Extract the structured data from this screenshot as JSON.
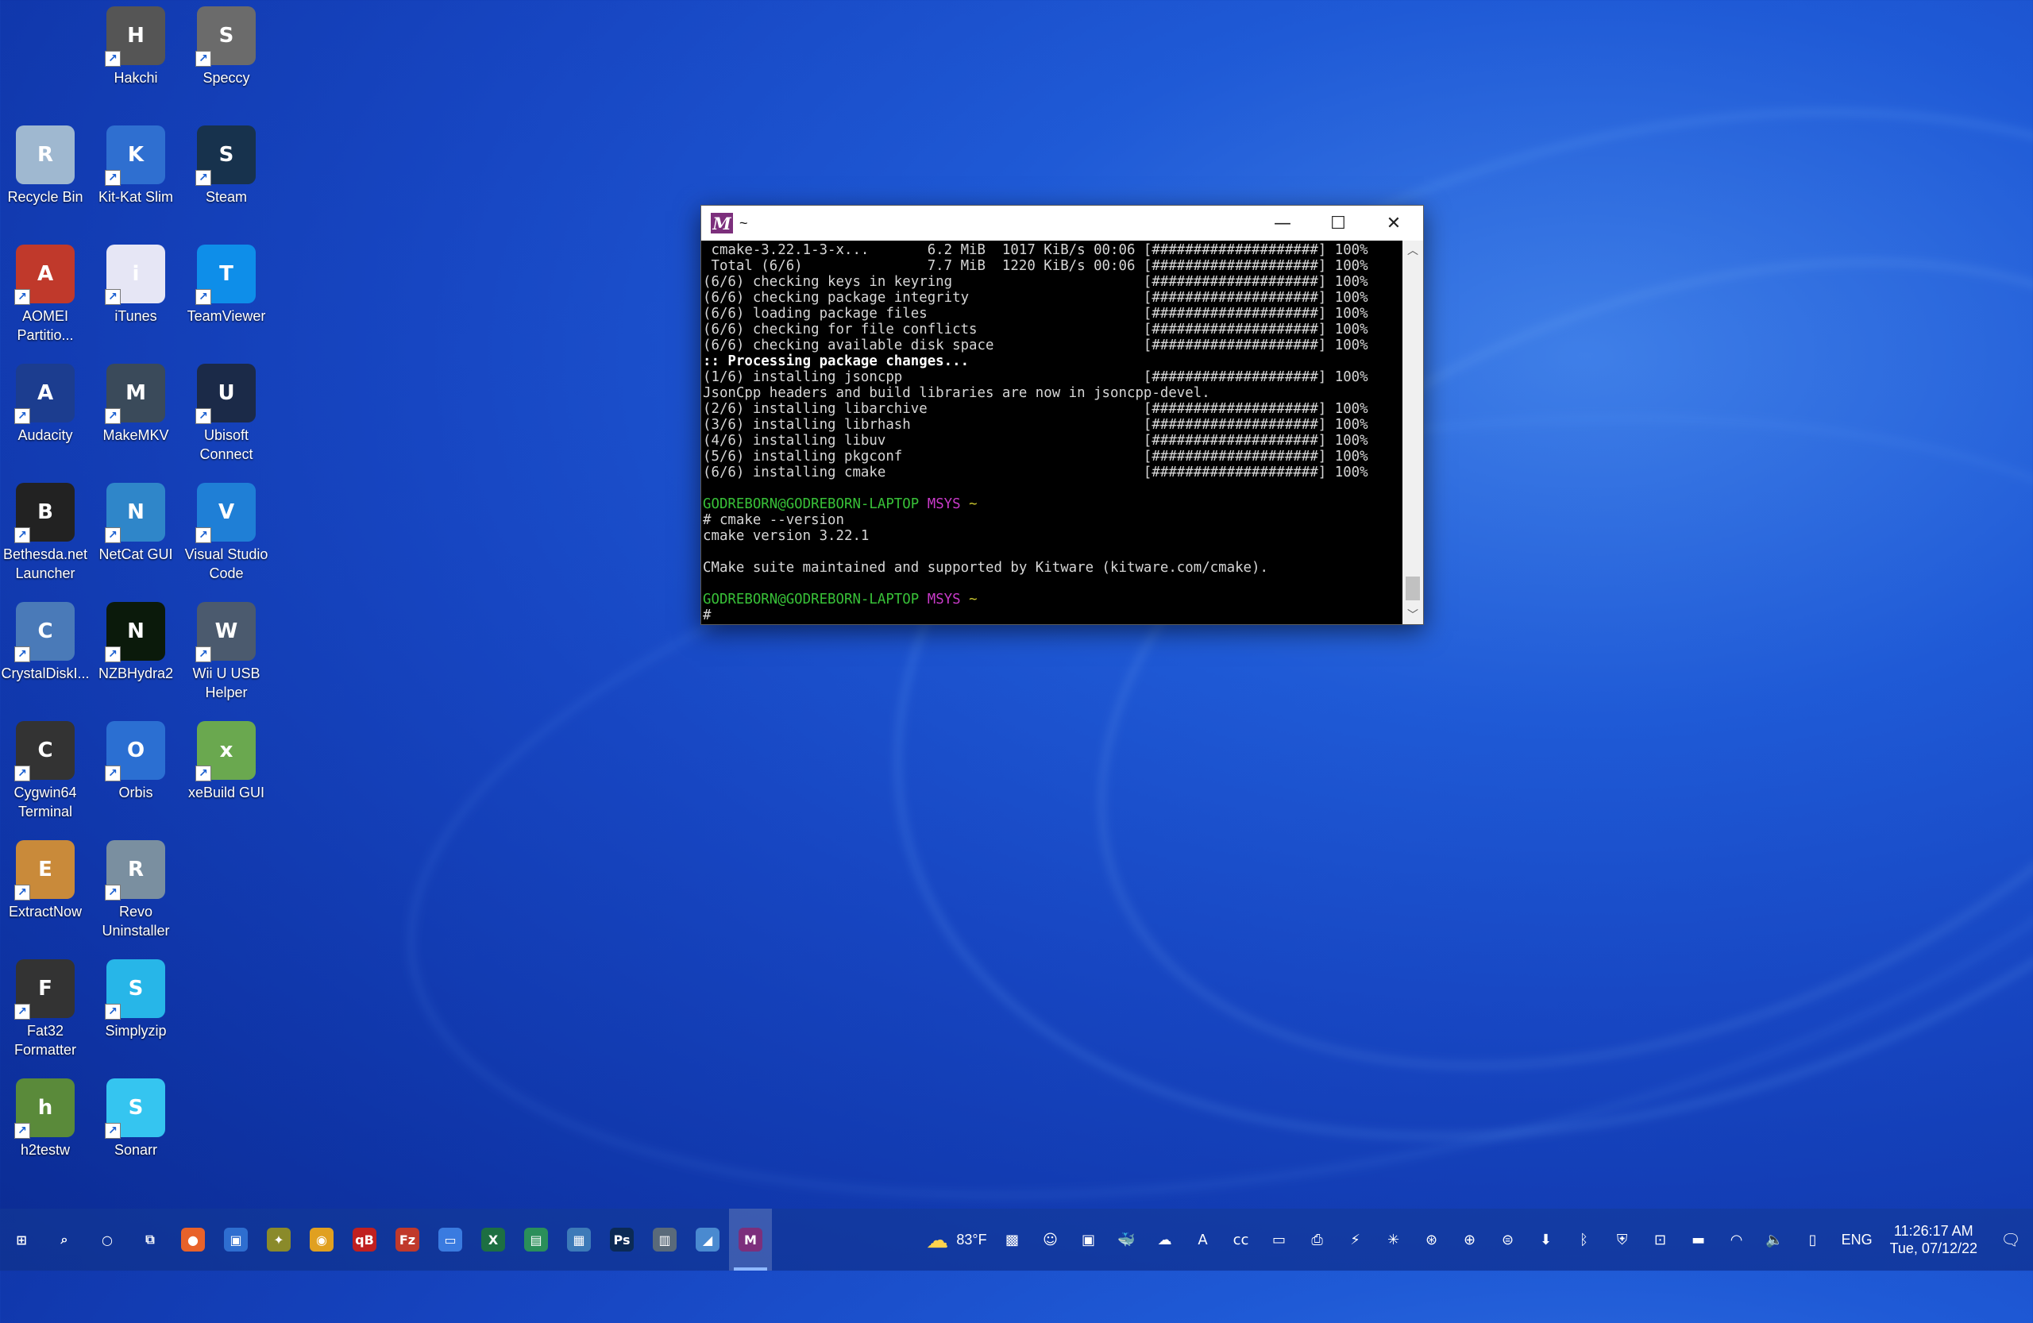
{
  "desktop": {
    "icons": [
      {
        "label": "Hakchi",
        "icon": "hakchi-icon",
        "color": "#555"
      },
      {
        "label": "Speccy",
        "icon": "speccy-icon",
        "color": "#6b6b6b"
      },
      {
        "label": "Recycle Bin",
        "icon": "recycle-bin-icon",
        "color": "#9fb8d0"
      },
      {
        "label": "Kit-Kat Slim",
        "icon": "kit-kat-slim-icon",
        "color": "#2f6fd0"
      },
      {
        "label": "Steam",
        "icon": "steam-icon",
        "color": "#17324d"
      },
      {
        "label": "AOMEI Partitio...",
        "icon": "aomei-icon",
        "color": "#c0392b"
      },
      {
        "label": "iTunes",
        "icon": "itunes-icon",
        "color": "#e6e6f5"
      },
      {
        "label": "TeamViewer",
        "icon": "teamviewer-icon",
        "color": "#0e8ee9"
      },
      {
        "label": "Audacity",
        "icon": "audacity-icon",
        "color": "#1c3d8f"
      },
      {
        "label": "MakeMKV",
        "icon": "makemkv-icon",
        "color": "#3a4a5a"
      },
      {
        "label": "Ubisoft Connect",
        "icon": "ubisoft-icon",
        "color": "#1b2a48"
      },
      {
        "label": "Bethesda.net Launcher",
        "icon": "bethesda-icon",
        "color": "#222"
      },
      {
        "label": "NetCat GUI",
        "icon": "netcat-icon",
        "color": "#2f86c9"
      },
      {
        "label": "Visual Studio Code",
        "icon": "vscode-icon",
        "color": "#1f7fd6"
      },
      {
        "label": "CrystalDiskI...",
        "icon": "crystaldisk-icon",
        "color": "#4a7ab8"
      },
      {
        "label": "NZBHydra2",
        "icon": "nzbhydra-icon",
        "color": "#0b1a0b"
      },
      {
        "label": "Wii U USB Helper",
        "icon": "wiiu-helper-icon",
        "color": "#4b5a6e"
      },
      {
        "label": "Cygwin64 Terminal",
        "icon": "cygwin-icon",
        "color": "#333"
      },
      {
        "label": "Orbis",
        "icon": "orbis-icon",
        "color": "#2b6fd2"
      },
      {
        "label": "xeBuild GUI",
        "icon": "xebuild-icon",
        "color": "#6aa84f"
      },
      {
        "label": "ExtractNow",
        "icon": "extractnow-icon",
        "color": "#c98a3a"
      },
      {
        "label": "Revo Uninstaller",
        "icon": "revo-icon",
        "color": "#7a8fa0"
      },
      {
        "label": "Fat32 Formatter",
        "icon": "fat32-icon",
        "color": "#333"
      },
      {
        "label": "Simplyzip",
        "icon": "simplyzip-icon",
        "color": "#27b6e8"
      },
      {
        "label": "h2testw",
        "icon": "h2testw-icon",
        "color": "#5a8a3a"
      },
      {
        "label": "Sonarr",
        "icon": "sonarr-icon",
        "color": "#35c5f0"
      }
    ]
  },
  "terminal": {
    "title": "~",
    "minimize": "—",
    "maximize": "☐",
    "close": "✕",
    "lines": [
      {
        "text": " cmake-3.22.1-3-x...       6.2 MiB  1017 KiB/s 00:06 [####################] 100%",
        "style": ""
      },
      {
        "text": " Total (6/6)               7.7 MiB  1220 KiB/s 00:06 [####################] 100%",
        "style": ""
      },
      {
        "text": "(6/6) checking keys in keyring                       [####################] 100%",
        "style": ""
      },
      {
        "text": "(6/6) checking package integrity                     [####################] 100%",
        "style": ""
      },
      {
        "text": "(6/6) loading package files                          [####################] 100%",
        "style": ""
      },
      {
        "text": "(6/6) checking for file conflicts                    [####################] 100%",
        "style": ""
      },
      {
        "text": "(6/6) checking available disk space                  [####################] 100%",
        "style": ""
      },
      {
        "text": ":: Processing package changes...",
        "style": "bold"
      },
      {
        "text": "(1/6) installing jsoncpp                             [####################] 100%",
        "style": ""
      },
      {
        "text": "JsonCpp headers and build libraries are now in jsoncpp-devel.",
        "style": ""
      },
      {
        "text": "(2/6) installing libarchive                          [####################] 100%",
        "style": ""
      },
      {
        "text": "(3/6) installing librhash                            [####################] 100%",
        "style": ""
      },
      {
        "text": "(4/6) installing libuv                               [####################] 100%",
        "style": ""
      },
      {
        "text": "(5/6) installing pkgconf                             [####################] 100%",
        "style": ""
      },
      {
        "text": "(6/6) installing cmake                               [####################] 100%",
        "style": ""
      },
      {
        "text": "",
        "style": ""
      },
      {
        "text": "",
        "style": "prompt"
      },
      {
        "text": "# cmake --version",
        "style": ""
      },
      {
        "text": "cmake version 3.22.1",
        "style": ""
      },
      {
        "text": "",
        "style": ""
      },
      {
        "text": "CMake suite maintained and supported by Kitware (kitware.com/cmake).",
        "style": ""
      },
      {
        "text": "",
        "style": ""
      },
      {
        "text": "",
        "style": "prompt"
      },
      {
        "text": "#",
        "style": ""
      }
    ],
    "prompt": {
      "user": "GODREBORN@GODREBORN-LAPTOP",
      "env": "MSYS",
      "dir": "~"
    }
  },
  "taskbar": {
    "apps": [
      {
        "name": "start-button",
        "glyph": "⊞",
        "color": "transparent"
      },
      {
        "name": "search-icon",
        "glyph": "⌕",
        "color": "transparent"
      },
      {
        "name": "cortana-icon",
        "glyph": "○",
        "color": "transparent"
      },
      {
        "name": "task-view-icon",
        "glyph": "⧉",
        "color": "transparent"
      },
      {
        "name": "firefox-icon",
        "glyph": "●",
        "color": "#e8622a"
      },
      {
        "name": "app-window-icon",
        "glyph": "▣",
        "color": "#2e6ed0"
      },
      {
        "name": "app-tool-icon",
        "glyph": "✦",
        "color": "#8a8a2a"
      },
      {
        "name": "chrome-icon",
        "glyph": "◉",
        "color": "#e0a020"
      },
      {
        "name": "qbittorrent-icon",
        "glyph": "qB",
        "color": "#c02020"
      },
      {
        "name": "filezilla-icon",
        "glyph": "Fz",
        "color": "#c0392b"
      },
      {
        "name": "app-blue-icon",
        "glyph": "▭",
        "color": "#3a7be0"
      },
      {
        "name": "excel-icon",
        "glyph": "X",
        "color": "#1d6f42"
      },
      {
        "name": "app-green-icon",
        "glyph": "▤",
        "color": "#2a8f5a"
      },
      {
        "name": "control-panel-icon",
        "glyph": "▦",
        "color": "#3d7ab8"
      },
      {
        "name": "photoshop-icon",
        "glyph": "Ps",
        "color": "#0b2a55"
      },
      {
        "name": "calculator-icon",
        "glyph": "▥",
        "color": "#5a6a7a"
      },
      {
        "name": "app-folder-icon",
        "glyph": "◢",
        "color": "#4a8ad0"
      },
      {
        "name": "msys-icon",
        "glyph": "M",
        "color": "#7c2f7c"
      }
    ],
    "tray": {
      "weather_icon": "weather-icon",
      "temperature": "83°F",
      "language": "ENG",
      "time": "11:26:17 AM",
      "date": "Tue, 07/12/22",
      "icons": [
        "minecraft-icon",
        "discord-icon",
        "nvidia-icon",
        "docker-icon",
        "onedrive-icon",
        "font-icon",
        "cc-icon",
        "drive-icon",
        "printer-icon",
        "lightning-icon",
        "bluetooth-alt-icon",
        "steam-tray-icon",
        "lifebuoy-icon",
        "vpn-icon",
        "download-icon",
        "bluetooth-icon",
        "defender-icon",
        "display-icon",
        "battery-icon",
        "wifi-icon",
        "volume-icon",
        "usb-icon"
      ]
    }
  }
}
